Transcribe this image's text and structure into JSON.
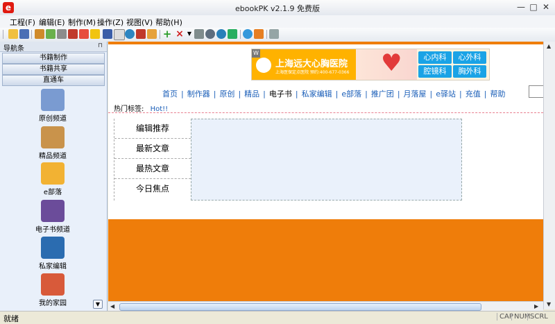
{
  "window": {
    "title": "ebookPK v2.1.9  免费版",
    "app_icon_glyph": "e",
    "minimize": "—",
    "maximize": "□",
    "close": "✕"
  },
  "menu": [
    "工程(F)",
    "编辑(E)",
    "制作(M)",
    "操作(Z)",
    "视图(V)",
    "帮助(H)"
  ],
  "toolbar": {
    "icons": [
      "open-icon",
      "save-icon",
      "wand-icon",
      "android-icon",
      "print-icon",
      "download-icon",
      "pdf-icon",
      "help-icon",
      "word-icon",
      "document-icon",
      "globe-icon",
      "eraser-icon",
      "tag-icon",
      "add-icon",
      "delete-icon",
      "dropdown-icon",
      "chart-icon",
      "search-icon",
      "refresh-icon",
      "play-icon",
      "headset-icon",
      "home-icon",
      "screen-icon"
    ]
  },
  "sidebar": {
    "title": "导航条",
    "pin": "⊓",
    "tabs": [
      "书籍制作",
      "书籍共享",
      "直通车"
    ],
    "items": [
      {
        "label": "原创频道",
        "icon": "paint-icon",
        "color": "#7a9bd1"
      },
      {
        "label": "精品频道",
        "icon": "box-icon",
        "color": "#c9934b"
      },
      {
        "label": "e部落",
        "icon": "people-icon",
        "color": "#f2b233"
      },
      {
        "label": "电子书频道",
        "icon": "books-icon",
        "color": "#6b4c9a"
      },
      {
        "label": "私家编辑",
        "icon": "runner-icon",
        "color": "#2b6cb0"
      },
      {
        "label": "我的家园",
        "icon": "flowerpot-icon",
        "color": "#d85a3a"
      }
    ]
  },
  "content": {
    "banner": {
      "mark": "W",
      "hospital": "上海远大心胸医院",
      "sub": "上海医保定点医院  预约:400-677-0366",
      "buttons": [
        "心内科",
        "心外科",
        "腔镜科",
        "胸外科"
      ]
    },
    "nav_links": [
      "首页",
      "制作器",
      "原创",
      "精品",
      "电子书",
      "私家编辑",
      "e部落",
      "推广团",
      "月落屋",
      "e驿站",
      "充值",
      "帮助"
    ],
    "current_link": "电子书",
    "hot_label": "热门标签:",
    "hot_link": "Hot!!",
    "categories": [
      "编辑推荐",
      "最新文章",
      "最热文章",
      "今日焦点"
    ]
  },
  "status": {
    "text": "就绪",
    "indicators": [
      "CAP",
      "NUM",
      "SCRL"
    ]
  },
  "colors": {
    "accent_orange": "#ef7d0a",
    "link_blue": "#1a5eb8"
  }
}
